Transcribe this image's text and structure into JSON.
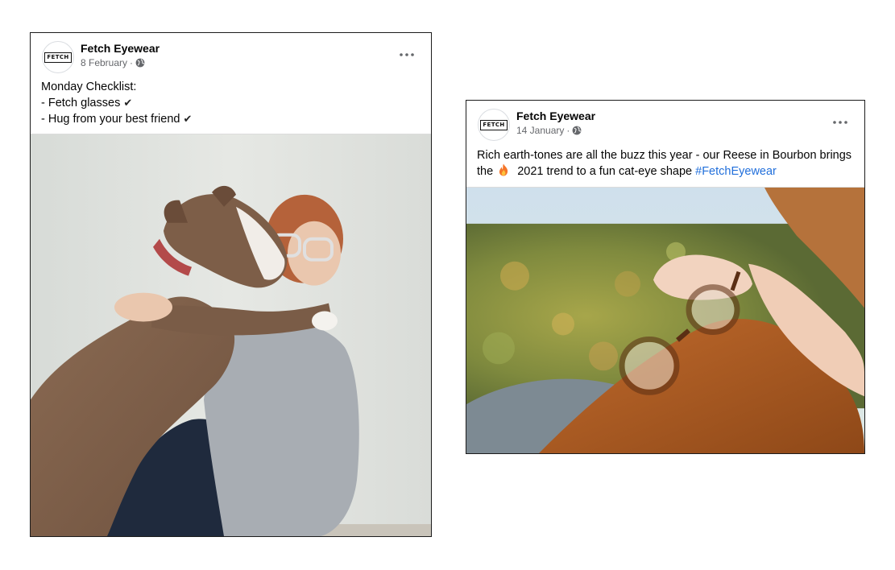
{
  "posts": [
    {
      "page_name": "Fetch Eyewear",
      "avatar_logo_text": "FETCH",
      "date": "8 February",
      "separator": "·",
      "privacy_icon": "globe-icon",
      "more_icon": "more-horizontal-icon",
      "lines": [
        "Monday Checklist:",
        "- Fetch glasses",
        "- Hug from your best friend"
      ],
      "check_glyph": "✔",
      "photo_icon": "photo-dog-hugging-woman"
    },
    {
      "page_name": "Fetch Eyewear",
      "avatar_logo_text": "FETCH",
      "date": "14 January",
      "separator": "·",
      "privacy_icon": "globe-icon",
      "more_icon": "more-horizontal-icon",
      "text_part1": "Rich earth-tones are all the buzz this year - our Reese in Bourbon brings the",
      "fire_icon": "fire-emoji-icon",
      "text_part2": "2021 trend to a fun cat-eye shape",
      "hashtag": "#FetchEyewear",
      "photo_icon": "photo-hand-holding-glasses"
    }
  ],
  "colors": {
    "meta_text": "#65676b",
    "hashtag": "#216fdb",
    "border": "#1c1c1c"
  }
}
